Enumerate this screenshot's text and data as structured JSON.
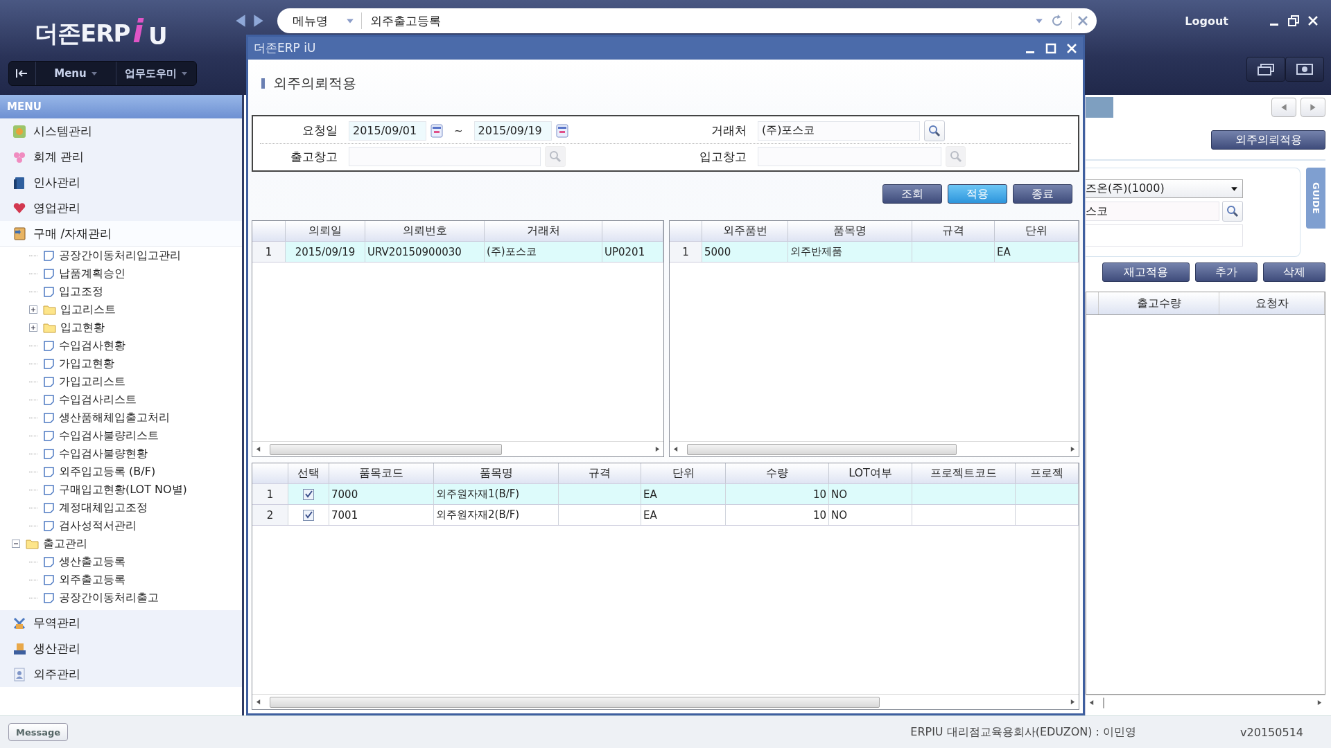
{
  "header": {
    "logo": {
      "brand": "더존ERP",
      "mark": "i",
      "suffix": "U"
    },
    "menu_bar": [
      {
        "label": "Menu"
      },
      {
        "label": "업무도우미"
      }
    ],
    "search": {
      "scope": "메뉴명",
      "value": "외주출고등록"
    },
    "logout": "Logout"
  },
  "sidebar": {
    "title": "MENU",
    "modules": [
      {
        "label": "시스템관리",
        "expanded": false
      },
      {
        "label": "회계 관리",
        "expanded": false
      },
      {
        "label": "인사관리",
        "expanded": false
      },
      {
        "label": "영업관리",
        "expanded": false
      },
      {
        "label": "구매 /자재관리",
        "expanded": true,
        "children": [
          {
            "kind": "group",
            "children": [
              {
                "kind": "page",
                "label": "공장간이동처리입고관리"
              },
              {
                "kind": "page",
                "label": "납품계획승인"
              },
              {
                "kind": "page",
                "label": "입고조정"
              },
              {
                "kind": "folder",
                "label": "입고리스트",
                "expanded": false
              },
              {
                "kind": "folder",
                "label": "입고현황",
                "expanded": false
              },
              {
                "kind": "page",
                "label": "수입검사현황"
              },
              {
                "kind": "page",
                "label": "가입고현황"
              },
              {
                "kind": "page",
                "label": "가입고리스트"
              },
              {
                "kind": "page",
                "label": "수입검사리스트"
              },
              {
                "kind": "page",
                "label": "생산품해체입출고처리"
              },
              {
                "kind": "page",
                "label": "수입검사불량리스트"
              },
              {
                "kind": "page",
                "label": "수입검사불량현황"
              },
              {
                "kind": "page",
                "label": "외주입고등록 (B/F)"
              },
              {
                "kind": "page",
                "label": "구매입고현황(LOT NO별)"
              },
              {
                "kind": "page",
                "label": "계정대체입고조정"
              },
              {
                "kind": "page",
                "label": "검사성적서관리"
              }
            ]
          },
          {
            "kind": "folder",
            "label": "출고관리",
            "expanded": true,
            "children": [
              {
                "kind": "page",
                "label": "생산출고등록"
              },
              {
                "kind": "page",
                "label": "외주출고등록"
              },
              {
                "kind": "page",
                "label": "공장간이동처리출고"
              }
            ]
          }
        ]
      },
      {
        "label": "무역관리",
        "expanded": false
      },
      {
        "label": "생산관리",
        "expanded": false
      },
      {
        "label": "외주관리",
        "expanded": false
      }
    ]
  },
  "dialog": {
    "title": "더존ERP iU",
    "heading": "외주의뢰적용",
    "filters": [
      {
        "kind": "date_range",
        "label": "요청일",
        "from": "2015/09/01",
        "separator": "~",
        "to": "2015/09/19"
      },
      {
        "kind": "lookup",
        "label": "거래처",
        "value": "(주)포스코",
        "disabled": false
      },
      {
        "kind": "lookup",
        "label": "출고창고",
        "disabled": true
      },
      {
        "kind": "lookup",
        "label": "입고창고",
        "disabled": true
      }
    ],
    "buttons": [
      {
        "label": "조회",
        "highlighted": false
      },
      {
        "label": "적용",
        "highlighted": true
      },
      {
        "label": "종료",
        "highlighted": false
      }
    ],
    "request_grid": {
      "columns": [
        "의뢰일",
        "의뢰번호",
        "거래처"
      ],
      "rows": [
        {
          "no": "1",
          "selected": true,
          "cells": [
            "2015/09/19",
            "URV20150900030",
            "(주)포스코",
            "UP0201"
          ]
        }
      ]
    },
    "item_grid": {
      "columns": [
        "외주품번",
        "품목명",
        "규격",
        "단위"
      ],
      "rows": [
        {
          "no": "1",
          "selected": true,
          "cells": [
            "5000",
            "외주반제품",
            null,
            "EA"
          ]
        }
      ]
    },
    "material_grid": {
      "columns": [
        "선택",
        "품목코드",
        "품목명",
        "규격",
        "단위",
        "수량",
        "LOT여부",
        "프로젝트코드",
        "프로젝"
      ],
      "rows": [
        {
          "no": "1",
          "selected": true,
          "checked": true,
          "cells": [
            "7000",
            "외주원자재1(B/F)",
            null,
            "EA",
            "10",
            "NO",
            null,
            null
          ]
        },
        {
          "no": "2",
          "selected": false,
          "checked": true,
          "cells": [
            "7001",
            "외주원자재2(B/F)",
            null,
            "EA",
            "10",
            "NO",
            null,
            null
          ]
        }
      ]
    }
  },
  "background_form": {
    "apply_button": "외주의뢰적용",
    "company": "즈온(주)(1000)",
    "partner": "스코",
    "guide": "GUIDE",
    "actions": [
      "재고적용",
      "추가",
      "삭제"
    ],
    "columns": [
      "출고수량",
      "요청자"
    ]
  },
  "status_bar": {
    "message_button": "Message",
    "user": "ERPIU 대리점교육용회사(EDUZON) : 이민영",
    "version": "v20150514"
  }
}
